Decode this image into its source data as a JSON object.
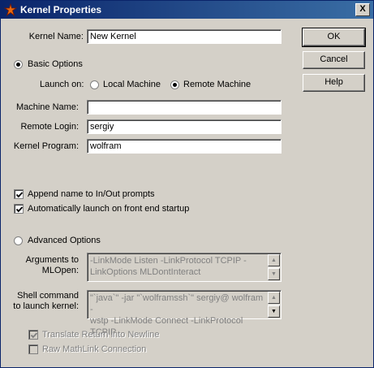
{
  "window": {
    "title": "Kernel Properties",
    "close_label": "X"
  },
  "buttons": {
    "ok": "OK",
    "cancel": "Cancel",
    "help": "Help"
  },
  "kernel_name": {
    "label": "Kernel Name:",
    "value": "New Kernel"
  },
  "basic_options": {
    "label": "Basic Options",
    "selected": true,
    "launch_on_label": "Launch on:",
    "local_machine": "Local Machine",
    "remote_machine": "Remote Machine",
    "launch_selected": "Remote Machine",
    "machine_name": {
      "label": "Machine Name:",
      "value": ""
    },
    "remote_login": {
      "label": "Remote Login:",
      "value": "sergiy"
    },
    "kernel_program": {
      "label": "Kernel Program:",
      "value": "wolfram"
    }
  },
  "checkboxes": {
    "append_name": {
      "label": "Append name to In/Out prompts",
      "checked": true
    },
    "auto_launch": {
      "label": "Automatically launch on front end startup",
      "checked": true
    }
  },
  "advanced_options": {
    "label": "Advanced Options",
    "selected": false,
    "arguments_label_1": "Arguments to",
    "arguments_label_2": "MLOpen:",
    "arguments_value": "-LinkMode Listen -LinkProtocol TCPIP -\nLinkOptions MLDontInteract",
    "shell_label_1": "Shell command",
    "shell_label_2": "to launch kernel:",
    "shell_value": "\"`java`\" -jar \"`wolframssh`\" sergiy@ wolfram -\nwstp -LinkMode Connect -LinkProtocol TCPIP",
    "translate_return": {
      "label": "Translate Return into Newline",
      "checked": true
    },
    "raw_mathlink": {
      "label": "Raw MathLink Connection",
      "checked": false
    }
  }
}
